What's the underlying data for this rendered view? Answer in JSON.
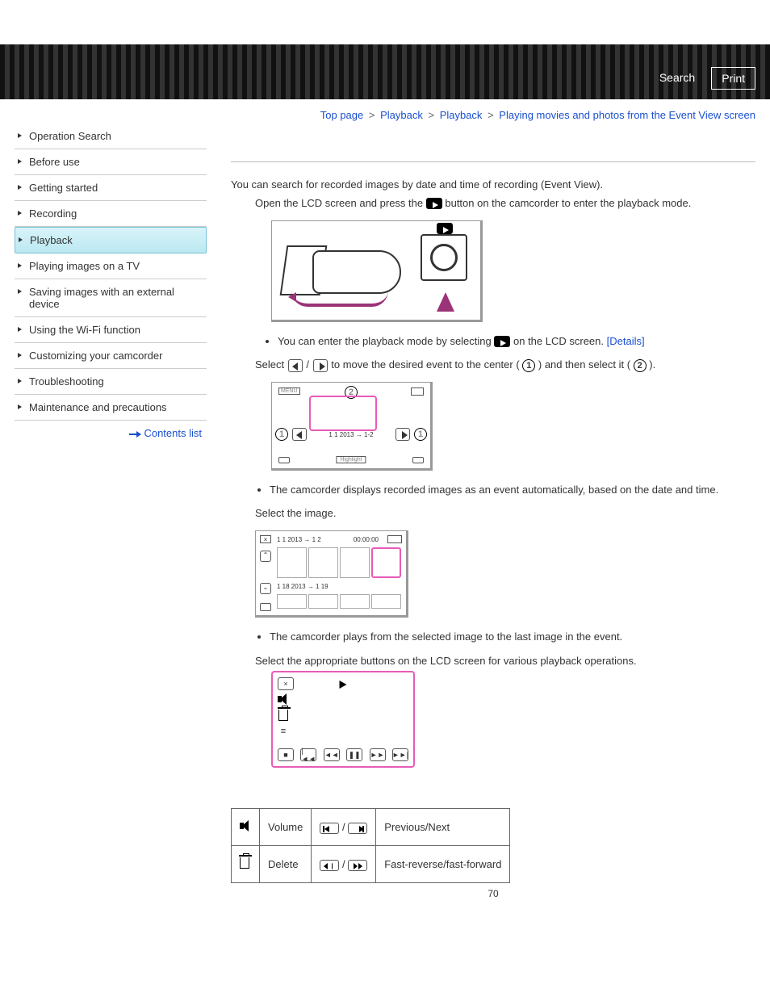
{
  "header": {
    "search": "Search",
    "print": "Print"
  },
  "sidebar": {
    "items": [
      "Operation Search",
      "Before use",
      "Getting started",
      "Recording",
      "Playback",
      "Playing images on a TV",
      "Saving images with an external device",
      "Using the Wi-Fi function",
      "Customizing your camcorder",
      "Troubleshooting",
      "Maintenance and precautions"
    ],
    "active_index": 4,
    "contents_list": "Contents list"
  },
  "breadcrumb": {
    "top": "Top page",
    "a": "Playback",
    "b": "Playback",
    "c": "Playing movies and photos from the Event View screen",
    "gt": ">"
  },
  "content": {
    "intro": "You can search for recorded images by date and time of recording (Event View).",
    "step_open_pre": "Open the LCD screen and press the ",
    "step_open_post": " button on the camcorder to enter the playback mode.",
    "bullet_enter_pre": "You can enter the playback mode by selecting ",
    "bullet_enter_post": " on the LCD screen. ",
    "details": "[Details]",
    "select_pre": "Select ",
    "select_mid": " / ",
    "select_mid2": " to move the desired event to the center ( ",
    "select_mid3": " ) and then select it ( ",
    "select_end": " ).",
    "fig2_menu": "MENU",
    "fig2_date": "1 1 2013 → 1-2",
    "fig2_highlight": "Highlight",
    "bullet_auto": "The camcorder displays recorded images as an event automatically, based on the date and time.",
    "select_image": "Select the image.",
    "fig3_x": "×",
    "fig3_d1": "1 1 2013 → 1 2",
    "fig3_tc": "00:00:00",
    "fig3_d2": "1 18 2013 → 1 19",
    "bullet_plays": "The camcorder plays from the selected image to the last image in the event.",
    "select_appropriate": "Select the appropriate buttons on the LCD screen for various playback operations."
  },
  "table": {
    "r1c2": "Volume",
    "r1c4": "Previous/Next",
    "r2c2": "Delete",
    "r2c4": "Fast-reverse/fast-forward",
    "slash": " / "
  },
  "page_number": "70"
}
